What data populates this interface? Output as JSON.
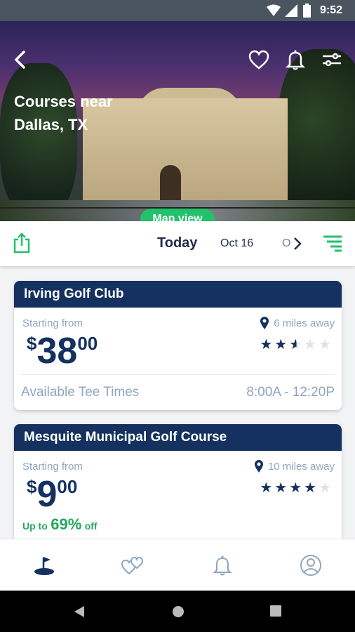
{
  "status_bar": {
    "time": "9:52"
  },
  "hero": {
    "title_line1": "Courses near",
    "title_line2": "Dallas, TX",
    "map_view_label": "Map view",
    "icons": [
      "back-icon",
      "heart-icon",
      "bell-icon",
      "filter-icon"
    ]
  },
  "date_bar": {
    "today_label": "Today",
    "next_date": "Oct 16",
    "partial_date": "O"
  },
  "courses": [
    {
      "name": "Irving Golf Club",
      "starting_from_label": "Starting from",
      "currency": "$",
      "price_dollars": "38",
      "price_cents": "00",
      "distance": "6 miles away",
      "rating": 2.5,
      "rating_max": 5,
      "available_label": "Available Tee Times",
      "time_range": "8:00A - 12:20P"
    },
    {
      "name": "Mesquite Municipal Golf Course",
      "starting_from_label": "Starting from",
      "currency": "$",
      "price_dollars": "9",
      "price_cents": "00",
      "distance": "10 miles away",
      "rating": 4,
      "rating_max": 5,
      "discount_prefix": "Up to",
      "discount_value": "69%",
      "discount_suffix": "off"
    }
  ],
  "bottom_nav": [
    "golf-icon",
    "hearts-icon",
    "bell-icon",
    "profile-icon"
  ],
  "colors": {
    "navy": "#14315f",
    "green": "#22c16b",
    "muted": "#8ea6bd"
  }
}
